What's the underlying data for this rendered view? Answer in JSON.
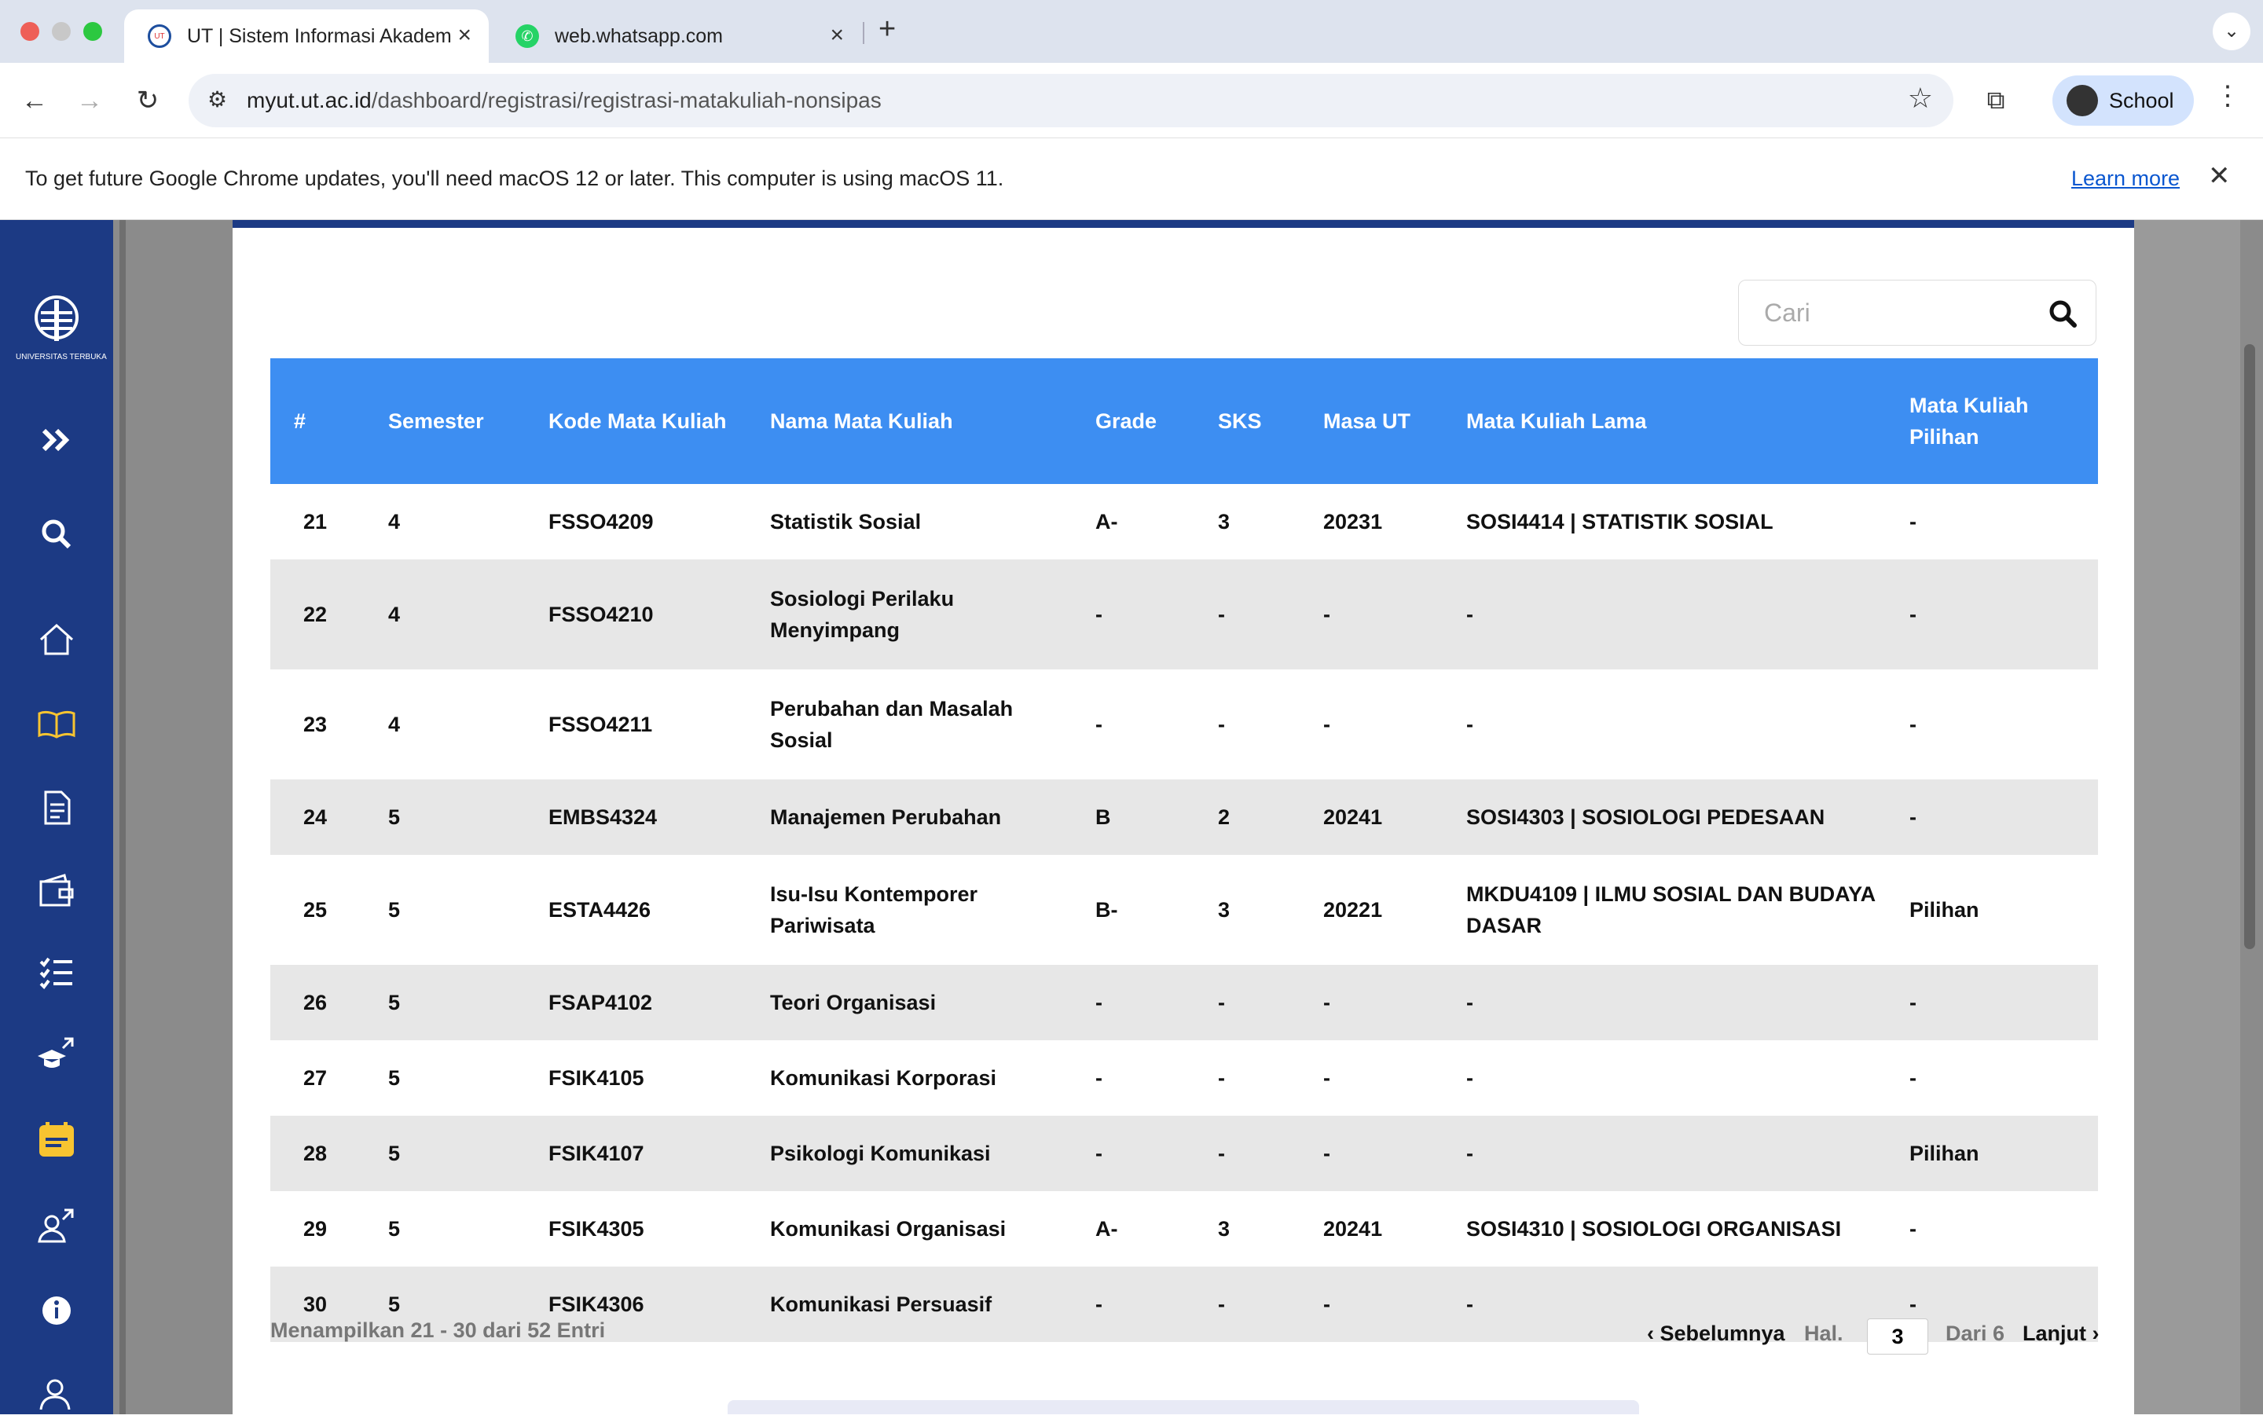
{
  "browser": {
    "tabs": [
      {
        "title": "UT | Sistem Informasi Akadem",
        "favicon": "ut-logo-icon"
      },
      {
        "title": "web.whatsapp.com",
        "favicon": "whatsapp-icon"
      }
    ],
    "new_tab": "+",
    "url_host": "myut.ut.ac.id",
    "url_path": "/dashboard/registrasi/registrasi-matakuliah-nonsipas",
    "profile_name": "School"
  },
  "infobar": {
    "message": "To get future Google Chrome updates, you'll need macOS 12 or later. This computer is using macOS 11.",
    "learn_more": "Learn more"
  },
  "sidebar": {
    "logo_text": "UNIVERSITAS TERBUKA",
    "items": [
      "expand-icon",
      "search-icon",
      "home-icon",
      "book-icon",
      "document-icon",
      "wallet-icon",
      "checklist-icon",
      "graduation-link-icon",
      "calendar-icon",
      "users-link-icon",
      "info-icon",
      "user-group-icon"
    ]
  },
  "search": {
    "placeholder": "Cari"
  },
  "table": {
    "headers": [
      "#",
      "Semester",
      "Kode Mata Kuliah",
      "Nama Mata Kuliah",
      "Grade",
      "SKS",
      "Masa UT",
      "Mata Kuliah Lama",
      "Mata Kuliah Pilihan"
    ],
    "rows": [
      [
        "21",
        "4",
        "FSSO4209",
        "Statistik Sosial",
        "A-",
        "3",
        "20231",
        "SOSI4414 | STATISTIK SOSIAL",
        "-"
      ],
      [
        "22",
        "4",
        "FSSO4210",
        "Sosiologi Perilaku Menyimpang",
        "-",
        "-",
        "-",
        "-",
        "-"
      ],
      [
        "23",
        "4",
        "FSSO4211",
        "Perubahan dan Masalah Sosial",
        "-",
        "-",
        "-",
        "-",
        "-"
      ],
      [
        "24",
        "5",
        "EMBS4324",
        "Manajemen Perubahan",
        "B",
        "2",
        "20241",
        "SOSI4303 | SOSIOLOGI PEDESAAN",
        "-"
      ],
      [
        "25",
        "5",
        "ESTA4426",
        "Isu-Isu Kontemporer Pariwisata",
        "B-",
        "3",
        "20221",
        "MKDU4109 | ILMU SOSIAL DAN BUDAYA DASAR",
        "Pilihan"
      ],
      [
        "26",
        "5",
        "FSAP4102",
        "Teori Organisasi",
        "-",
        "-",
        "-",
        "-",
        "-"
      ],
      [
        "27",
        "5",
        "FSIK4105",
        "Komunikasi Korporasi",
        "-",
        "-",
        "-",
        "-",
        "-"
      ],
      [
        "28",
        "5",
        "FSIK4107",
        "Psikologi Komunikasi",
        "-",
        "-",
        "-",
        "-",
        "Pilihan"
      ],
      [
        "29",
        "5",
        "FSIK4305",
        "Komunikasi Organisasi",
        "A-",
        "3",
        "20241",
        "SOSI4310 | SOSIOLOGI ORGANISASI",
        "-"
      ],
      [
        "30",
        "5",
        "FSIK4306",
        "Komunikasi Persuasif",
        "-",
        "-",
        "-",
        "-",
        "-"
      ]
    ]
  },
  "footer": {
    "summary": "Menampilkan 21 - 30 dari 52 Entri",
    "prev": "Sebelumnya",
    "hal": "Hal.",
    "page": "3",
    "dari": "Dari 6",
    "next": "Lanjut"
  },
  "colors": {
    "header_blue": "#3d8ef2",
    "sidebar_navy": "#1c3a84",
    "accent_yellow": "#f7c431"
  }
}
